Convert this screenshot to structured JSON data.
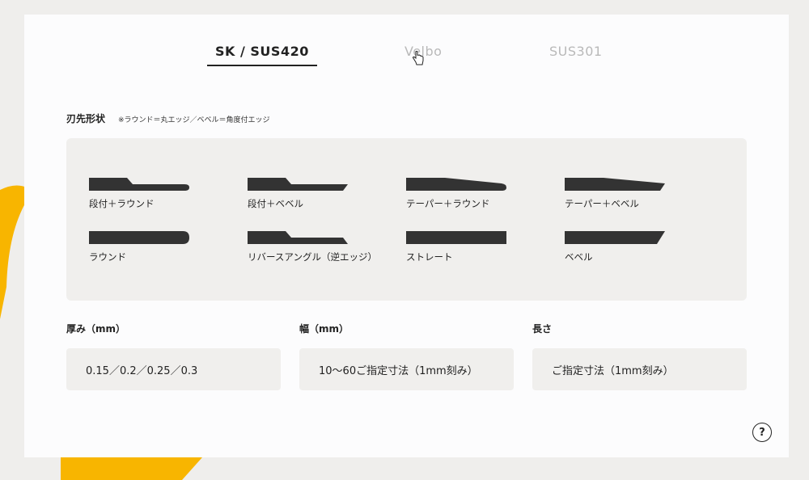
{
  "tabs": [
    {
      "label": "SK / SUS420",
      "active": true
    },
    {
      "label": "Velbo",
      "active": false
    },
    {
      "label": "SUS301",
      "active": false
    }
  ],
  "blade_shape": {
    "title": "刃先形状",
    "note": "※ラウンド＝丸エッジ／ベベル＝角度付エッジ",
    "items": [
      {
        "label": "段付＋ラウンド",
        "icon": "stepped-round-blade-icon"
      },
      {
        "label": "段付＋ベベル",
        "icon": "stepped-bevel-blade-icon"
      },
      {
        "label": "テーパー＋ラウンド",
        "icon": "taper-round-blade-icon"
      },
      {
        "label": "テーパー＋ベベル",
        "icon": "taper-bevel-blade-icon"
      },
      {
        "label": "ラウンド",
        "icon": "round-blade-icon"
      },
      {
        "label": "リバースアングル（逆エッジ）",
        "icon": "reverse-angle-blade-icon"
      },
      {
        "label": "ストレート",
        "icon": "straight-blade-icon"
      },
      {
        "label": "ベベル",
        "icon": "bevel-blade-icon"
      }
    ]
  },
  "specs": {
    "thickness": {
      "title": "厚み（mm）",
      "value": "0.15／0.2／0.25／0.3"
    },
    "width": {
      "title": "幅（mm）",
      "value": "10〜60ご指定寸法（1mm刻み）"
    },
    "length": {
      "title": "長さ",
      "value": "ご指定寸法（1mm刻み）"
    }
  },
  "help": {
    "label": "?"
  },
  "colors": {
    "accent": "#f8b500",
    "shape": "#333333",
    "panel": "#f0efed"
  }
}
